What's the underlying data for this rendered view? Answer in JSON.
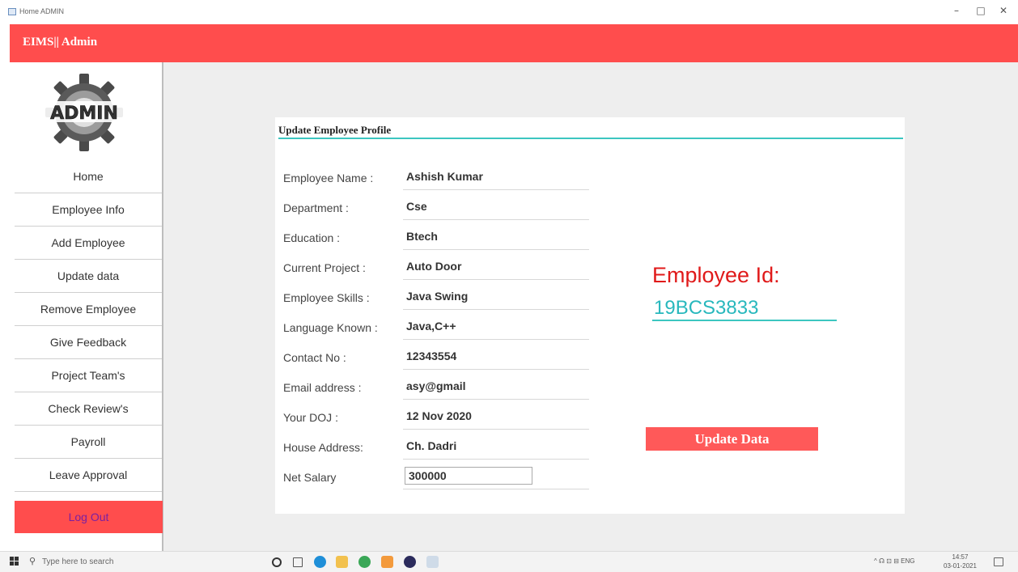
{
  "window": {
    "title": "Home ADMIN",
    "minimize": "–",
    "maximize": "□",
    "close": "✕"
  },
  "header": {
    "brand": "EIMS|| Admin"
  },
  "sidebar": {
    "logo_text": "ADMIN",
    "items": [
      {
        "label": "Home"
      },
      {
        "label": "Employee Info"
      },
      {
        "label": "Add Employee"
      },
      {
        "label": "Update data"
      },
      {
        "label": "Remove Employee"
      },
      {
        "label": "Give Feedback"
      },
      {
        "label": "Project Team's"
      },
      {
        "label": "Check Review's"
      },
      {
        "label": "Payroll"
      },
      {
        "label": "Leave Approval"
      }
    ],
    "logout": "Log Out"
  },
  "profile": {
    "title": "Update Employee Profile",
    "fields": [
      {
        "label": "Employee Name :",
        "value": "Ashish Kumar"
      },
      {
        "label": "Department :",
        "value": "Cse"
      },
      {
        "label": "Education :",
        "value": "Btech"
      },
      {
        "label": "Current Project :",
        "value": "Auto Door"
      },
      {
        "label": "Employee Skills :",
        "value": "Java Swing"
      },
      {
        "label": "Language Known :",
        "value": "Java,C++"
      },
      {
        "label": "Contact No :",
        "value": "12343554"
      },
      {
        "label": "Email address :",
        "value": "asy@gmail"
      },
      {
        "label": "Your DOJ :",
        "value": "12 Nov 2020"
      },
      {
        "label": "House Address:",
        "value": "Ch. Dadri"
      },
      {
        "label": "Net Salary",
        "value": "300000"
      }
    ],
    "employee_id_label": "Employee Id:",
    "employee_id": "19BCS3833",
    "update_button": "Update Data"
  },
  "taskbar": {
    "search_placeholder": "Type here to search",
    "tray_text": "^ ☊ ⊡ ⊟ ENG",
    "time": "14:57",
    "date": "03-01-2021"
  },
  "colors": {
    "accent_red": "#ff4d4d",
    "teal": "#3cc6c0",
    "id_red": "#e01a1a",
    "logout_text": "#7a1fa2"
  }
}
